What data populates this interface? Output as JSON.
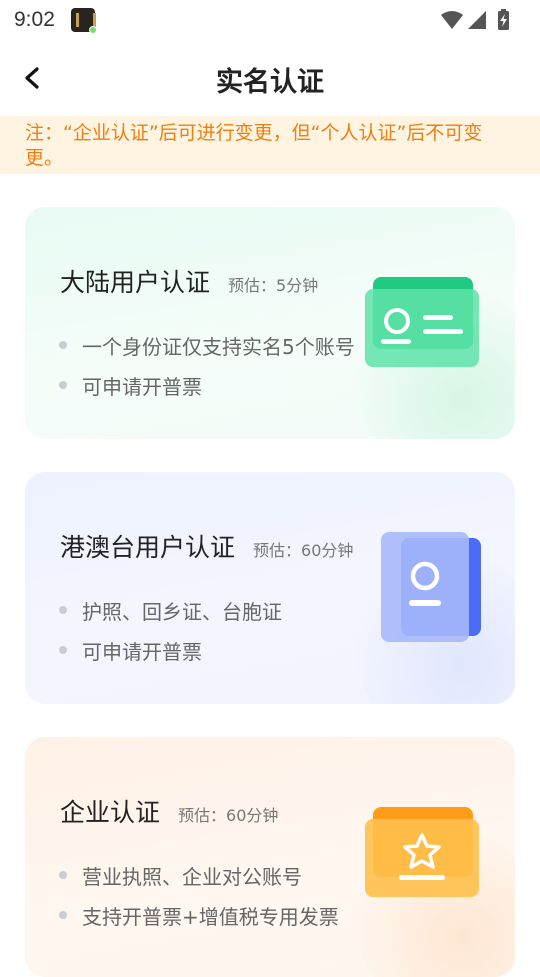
{
  "status_bar": {
    "time": "9:02"
  },
  "header": {
    "title": "实名认证"
  },
  "notice": {
    "text": "注：“企业认证”后可进行变更，但“个人认证”后不可变更。"
  },
  "cards": [
    {
      "title": "大陆用户认证",
      "estimate": "预估：5分钟",
      "bullets": [
        "一个身份证仅支持实名5个账号",
        "可申请开普票"
      ],
      "icon": "id-card-icon",
      "accent": "#2fd08a"
    },
    {
      "title": "港澳台用户认证",
      "estimate": "预估：60分钟",
      "bullets": [
        "护照、回乡证、台胞证",
        "可申请开普票"
      ],
      "icon": "passport-icon",
      "accent": "#4a6cf7"
    },
    {
      "title": "企业认证",
      "estimate": "预估：60分钟",
      "bullets": [
        "营业执照、企业对公账号",
        "支持开普票+增值税专用发票"
      ],
      "icon": "enterprise-star-icon",
      "accent": "#ffa21f"
    }
  ]
}
